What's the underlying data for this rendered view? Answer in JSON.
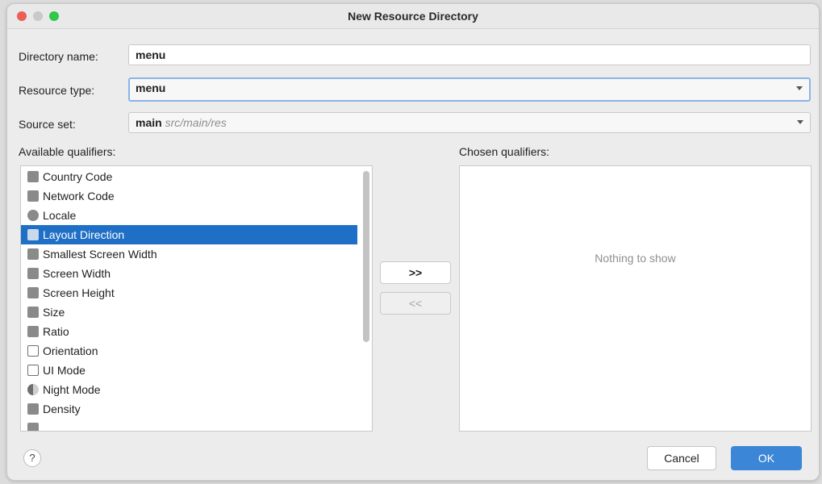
{
  "window": {
    "title": "New Resource Directory"
  },
  "form": {
    "directory_name_label": "Directory name:",
    "directory_name_value": "menu",
    "resource_type_label": "Resource type:",
    "resource_type_value": "menu",
    "source_set_label": "Source set:",
    "source_set_value": "main",
    "source_set_path": "src/main/res"
  },
  "available": {
    "label": "Available qualifiers:",
    "items": [
      {
        "label": "Country Code",
        "icon": "country-code-icon"
      },
      {
        "label": "Network Code",
        "icon": "network-code-icon"
      },
      {
        "label": "Locale",
        "icon": "globe-icon"
      },
      {
        "label": "Layout Direction",
        "icon": "layout-direction-icon",
        "selected": true
      },
      {
        "label": "Smallest Screen Width",
        "icon": "smallest-screen-width-icon"
      },
      {
        "label": "Screen Width",
        "icon": "screen-width-icon"
      },
      {
        "label": "Screen Height",
        "icon": "screen-height-icon"
      },
      {
        "label": "Size",
        "icon": "size-icon"
      },
      {
        "label": "Ratio",
        "icon": "ratio-icon"
      },
      {
        "label": "Orientation",
        "icon": "orientation-icon"
      },
      {
        "label": "UI Mode",
        "icon": "ui-mode-icon"
      },
      {
        "label": "Night Mode",
        "icon": "night-mode-icon"
      },
      {
        "label": "Density",
        "icon": "density-icon"
      }
    ]
  },
  "chosen": {
    "label": "Chosen qualifiers:",
    "empty_text": "Nothing to show"
  },
  "actions": {
    "add_label": ">>",
    "remove_label": "<<"
  },
  "footer": {
    "help_label": "?",
    "cancel_label": "Cancel",
    "ok_label": "OK"
  },
  "colors": {
    "selection": "#1f6fc6",
    "ok_button": "#3b86d6",
    "focus_ring": "#8ab5e6"
  }
}
